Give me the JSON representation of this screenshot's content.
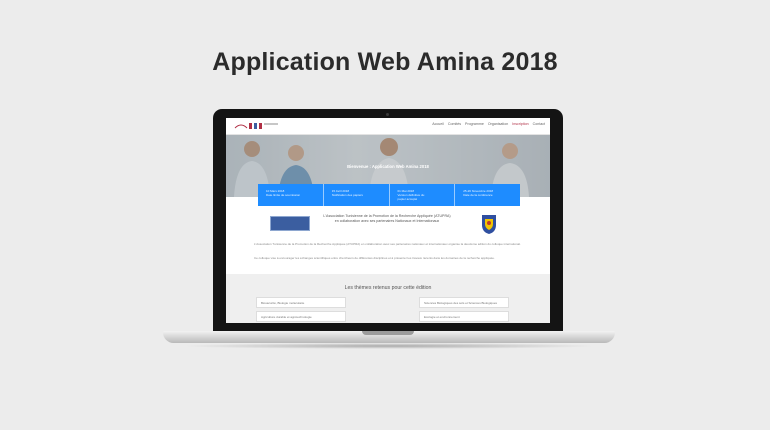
{
  "page": {
    "title": "Application Web Amina 2018"
  },
  "site": {
    "nav": [
      "Accueil",
      "Comités",
      "Programme",
      "Organisation",
      "Inscription",
      "Contact"
    ],
    "hero_heading": "Bienvenue : Application Web Amina 2018",
    "info": [
      {
        "lines": [
          "10 Mars 2018",
          "Date limite de soumission"
        ]
      },
      {
        "lines": [
          "15 Avril 2018",
          "Notification des papiers"
        ]
      },
      {
        "lines": [
          "01 Mai 2018",
          "Version définitive du",
          "papier accepté"
        ]
      },
      {
        "lines": [
          "25-26 Novembre 2018",
          "Date de la conférence"
        ]
      }
    ],
    "intro": "L'Association Tunisienne de la Promotion de la Recherche Appliquée (ATUPRA) en collaboration avec ses partenaires Nationaux et Internationaux",
    "body": [
      "L'Association Tunisienne de la Promotion de la Recherche Appliquée (ATUPRA) en collaboration avec ses partenaires nationaux et internationaux organise la deuxième édition du colloque international.",
      "Ce colloque vise à encourager les échanges scientifiques entre chercheurs de différentes disciplines et à présenter les travaux récents dans les domaines de la recherche appliquée."
    ],
    "themes_title": "Les thèmes retenus pour cette édition",
    "themes": [
      "Biosécurité, Biologie moléculaire",
      "Sciences Biologiques des sols et Sciences Biologiques",
      "Agriculture durable et agrotechnologie",
      "Ecologie et environnement"
    ]
  },
  "colors": {
    "accent": "#1e8cff",
    "brand": "#b02f45"
  }
}
